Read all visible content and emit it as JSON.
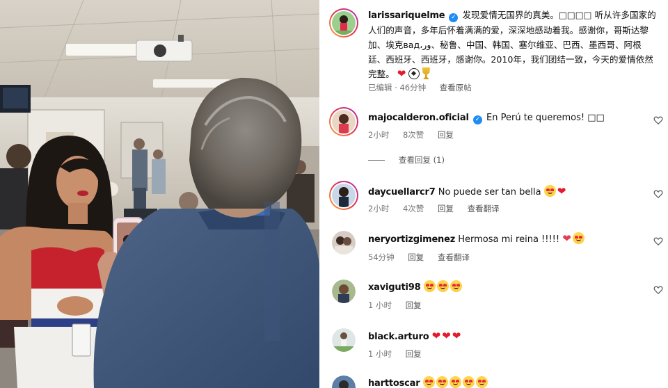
{
  "post": {
    "username": "larissariquelme",
    "caption": "发现爱情无国界的真美。□□□□ 听从许多国家的人们的声音，多年后怀着满满的爱，深深地感动着我。感谢你，哥斯达黎加、埃克вад،ور、秘鲁、中国、韩国、塞尔维亚、巴西、墨西哥、阿根廷、西班牙、西班牙，感谢你。2010年，我们团结一致，今天的爱情依然完整。",
    "edited_label": "已编辑 · 46分钟",
    "view_original": "查看原帖"
  },
  "comments": [
    {
      "username": "majocalderon.oficial",
      "verified": true,
      "text": "En Perú te queremos! □□",
      "time": "2小时",
      "likes": "8次赞",
      "reply": "回复",
      "view_replies": "查看回复 (1)"
    },
    {
      "username": "daycuellarcr7",
      "text": "No puede ser tan bella",
      "time": "2小时",
      "likes": "4次赞",
      "reply": "回复",
      "translate": "查看翻译"
    },
    {
      "username": "neryortizgimenez",
      "text": "Hermosa mi reina !!!!!",
      "time": "54分钟",
      "reply": "回复",
      "translate": "查看翻译"
    },
    {
      "username": "xaviguti98",
      "text": "",
      "time": "1 小时",
      "reply": "回复"
    },
    {
      "username": "black.arturo",
      "text": "",
      "time": "1 小时",
      "reply": "回复"
    },
    {
      "username": "harttoscar",
      "text": ""
    }
  ],
  "icons": {
    "verified": "verified-badge-icon",
    "like": "heart-outline-icon"
  },
  "colors": {
    "verified_blue": "#1f8cf5",
    "meta_gray": "#737373",
    "heart_red": "#e21b2e"
  }
}
